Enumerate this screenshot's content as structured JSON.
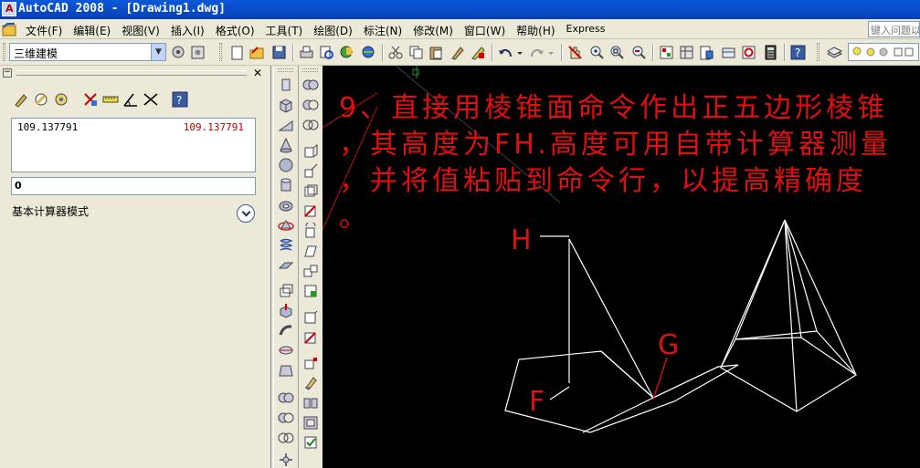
{
  "window": {
    "title": "AutoCAD 2008 - [Drawing1.dwg]"
  },
  "menu": {
    "items": [
      "文件(F)",
      "编辑(E)",
      "视图(V)",
      "插入(I)",
      "格式(O)",
      "工具(T)",
      "绘图(D)",
      "标注(N)",
      "修改(M)",
      "窗口(W)",
      "帮助(H)",
      "Express"
    ],
    "help_placeholder": "键入问题以"
  },
  "toolbar": {
    "workspace": "三维建模"
  },
  "calculator": {
    "history_expression": "109.137791",
    "history_result": "109.137791",
    "input_value": "0",
    "mode_label": "基本计算器模式"
  },
  "drawing": {
    "annotation_lines": [
      "9、直接用棱锥面命令作出正五边形棱锥",
      "，其高度为FH.高度可用自带计算器测量",
      "，并将值粘贴到命令行，以提高精确度",
      "。"
    ],
    "label_h": "H",
    "label_g": "G",
    "label_f": "F",
    "annotation_color": "#e01010",
    "line_color": "#ffffff"
  }
}
